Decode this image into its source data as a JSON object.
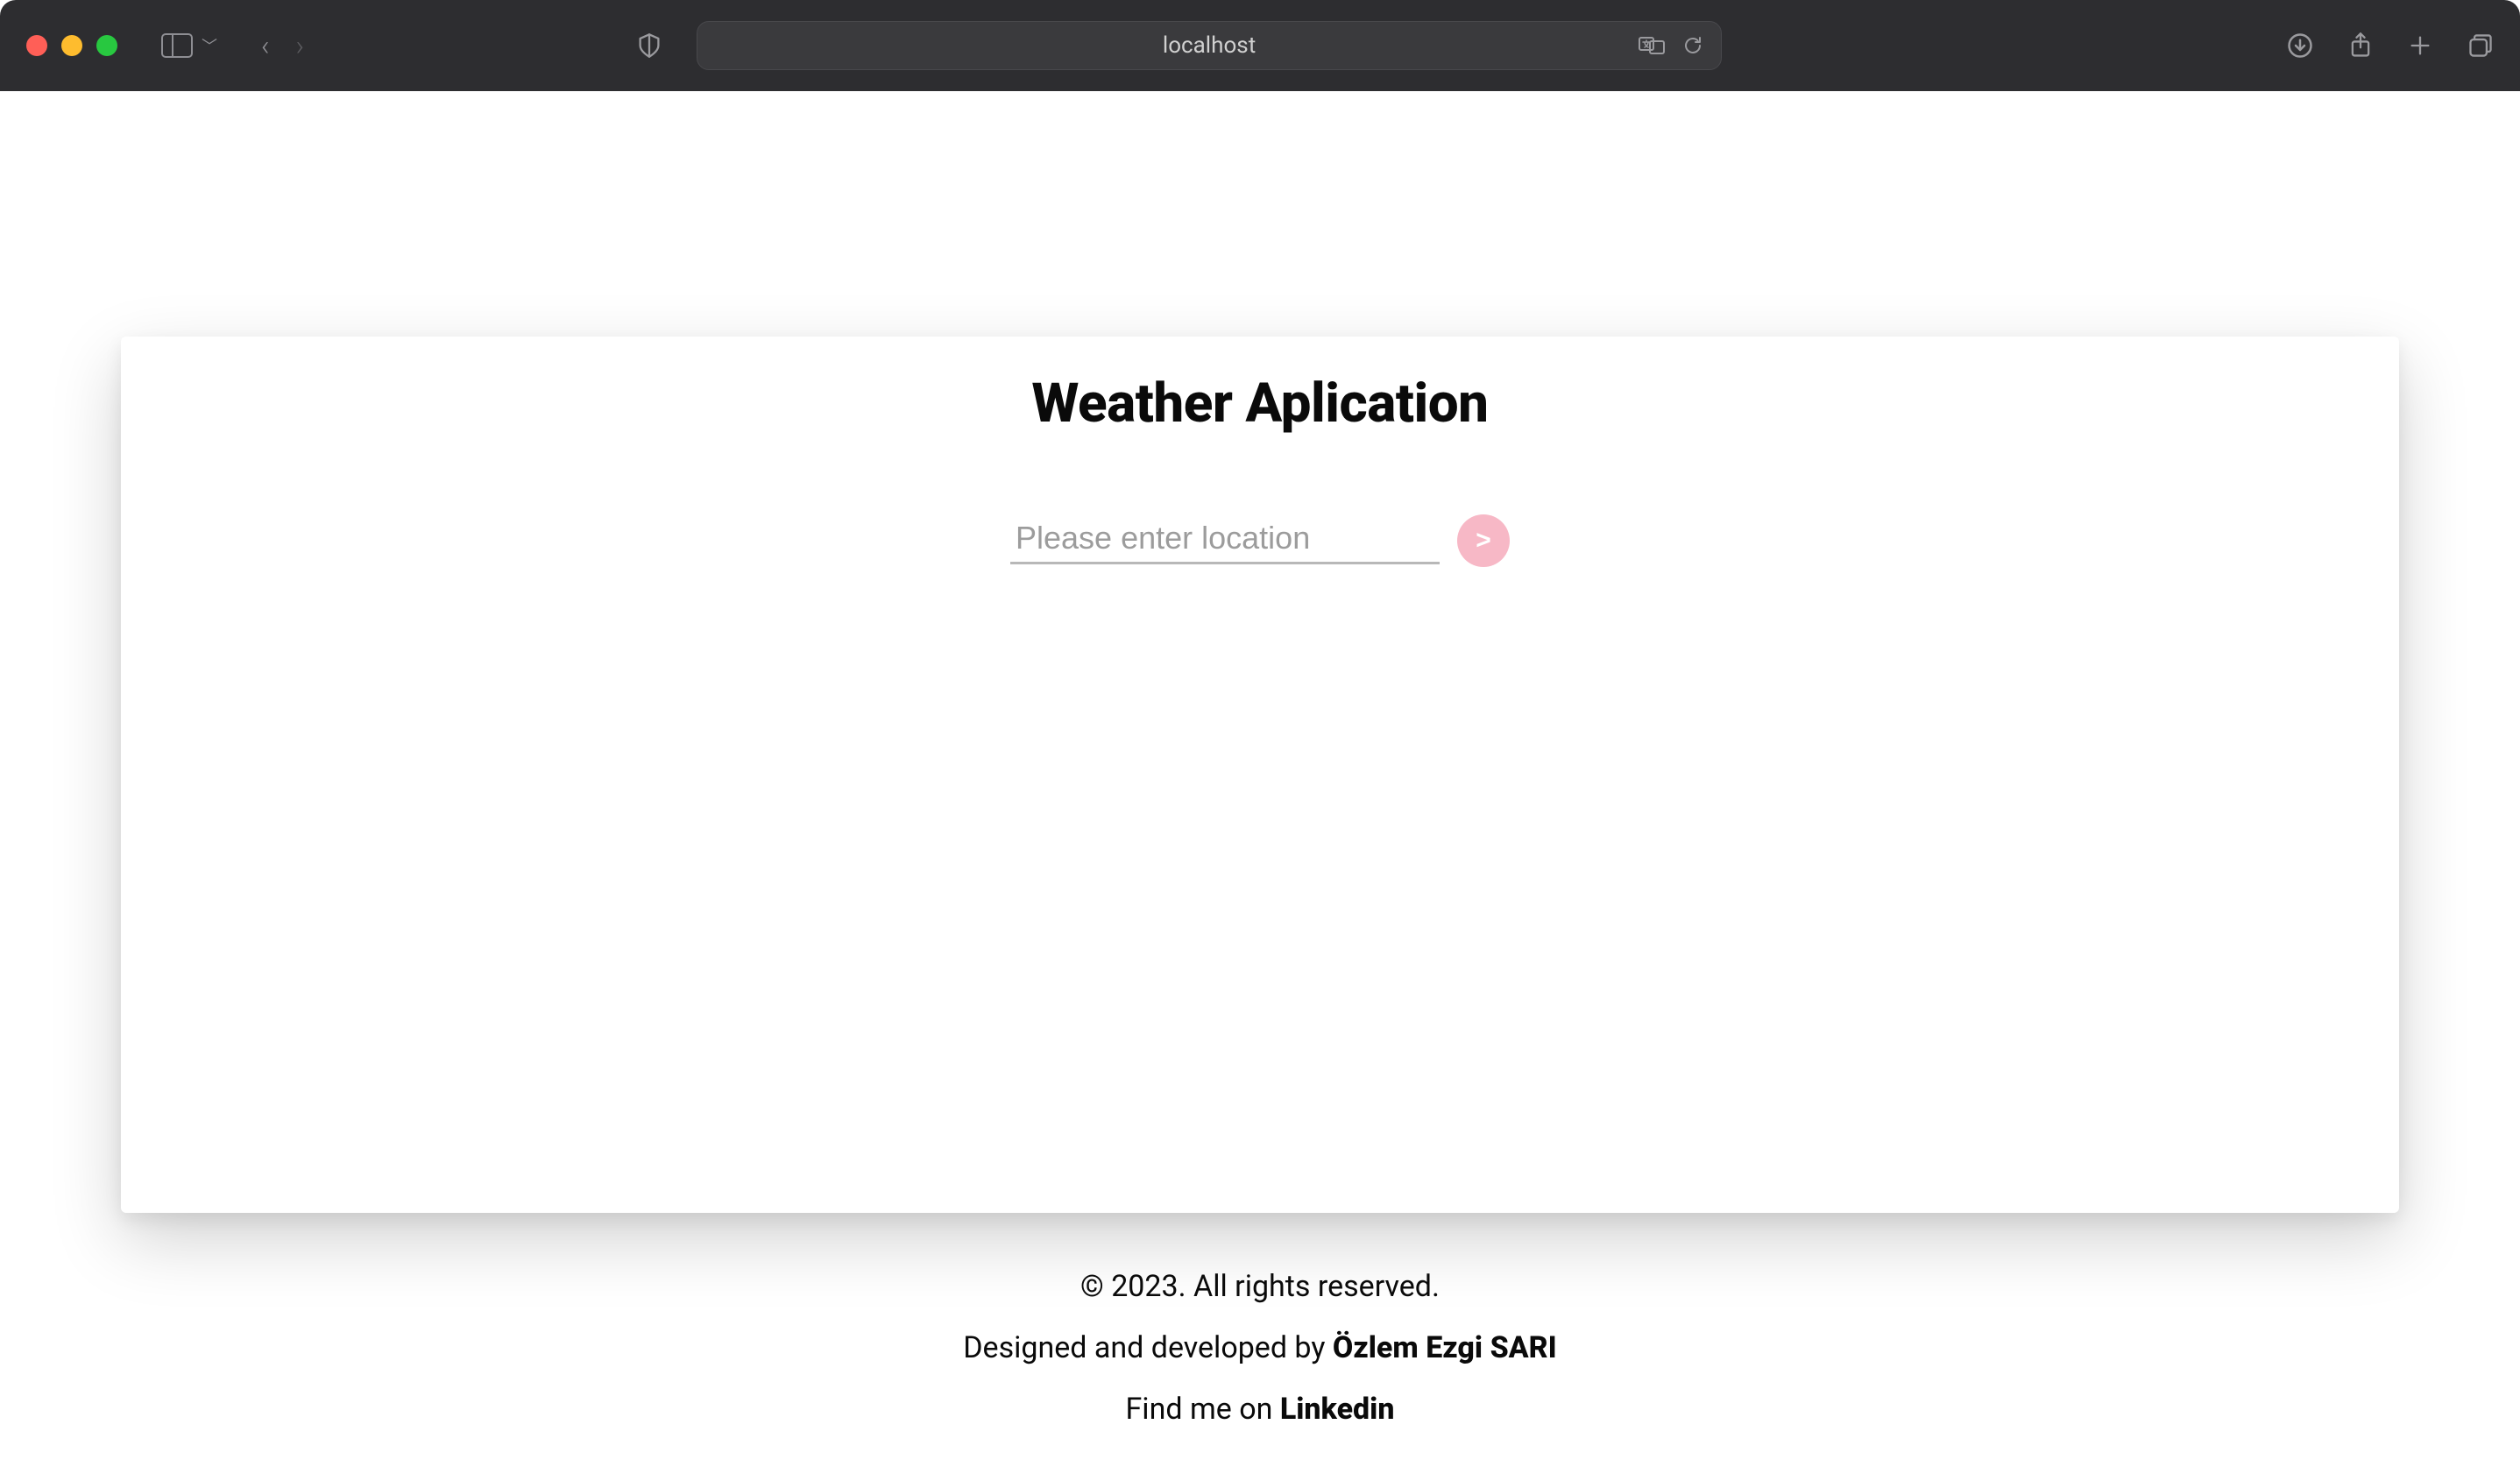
{
  "browser": {
    "address": "localhost"
  },
  "app": {
    "title": "Weather Aplication",
    "search": {
      "placeholder": "Please enter location",
      "value": "",
      "submit_label": ">"
    }
  },
  "footer": {
    "copyright": "© 2023. All rights reserved.",
    "designed_prefix": "Designed and developed by ",
    "designer_name": "Özlem Ezgi SARI",
    "findme_prefix": "Find me on ",
    "findme_link_label": "Linkedin"
  }
}
